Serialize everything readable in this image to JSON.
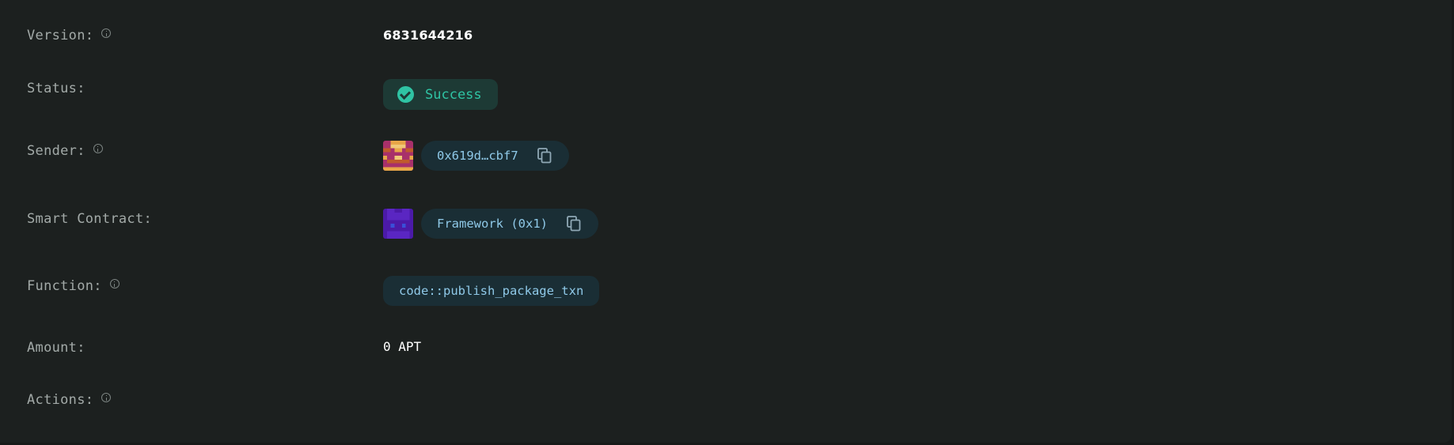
{
  "details": {
    "version": {
      "label": "Version:",
      "value": "6831644216"
    },
    "status": {
      "label": "Status:",
      "value": "Success",
      "color": "#2fc4a4"
    },
    "sender": {
      "label": "Sender:",
      "address": "0x619d…cbf7"
    },
    "smart_contract": {
      "label": "Smart Contract:",
      "name": "Framework (0x1)"
    },
    "function": {
      "label": "Function:",
      "value": "code::publish_package_txn"
    },
    "amount": {
      "label": "Amount:",
      "value": "0 APT"
    },
    "actions": {
      "label": "Actions:"
    }
  },
  "icons": {
    "info": "info-icon",
    "status": "check-circle-icon",
    "copy": "copy-icon"
  }
}
